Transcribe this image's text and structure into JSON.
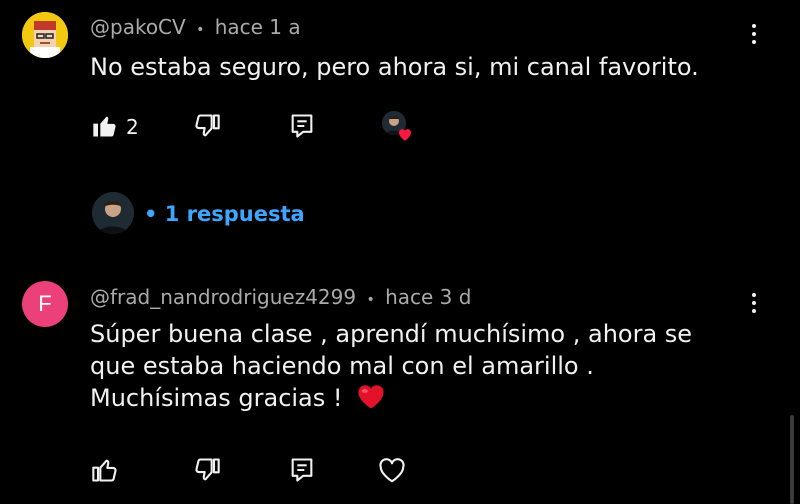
{
  "comments": [
    {
      "handle": "@pakoCV",
      "separator": "•",
      "time": "hace 1 a",
      "text": "No estaba seguro, pero ahora si, mi canal favorito.",
      "likes": "2",
      "liked": true,
      "replies_label": "• 1 respuesta"
    },
    {
      "handle": "@frad_nandrodriguez4299",
      "separator": "•",
      "time": "hace 3 d",
      "avatar_letter": "F",
      "avatar_color": "#ec407a",
      "text_lines": [
        "Súper buena clase , aprendí muchísimo , ahora se",
        "que estaba haciendo mal con el amarillo .",
        "Muchísimas gracias !"
      ],
      "emoji": "❤️"
    }
  ],
  "colors": {
    "background": "#000000",
    "text": "#f1f1f1",
    "meta": "#aaaaaa",
    "link": "#3ea6ff",
    "heart": "#ff1744"
  }
}
